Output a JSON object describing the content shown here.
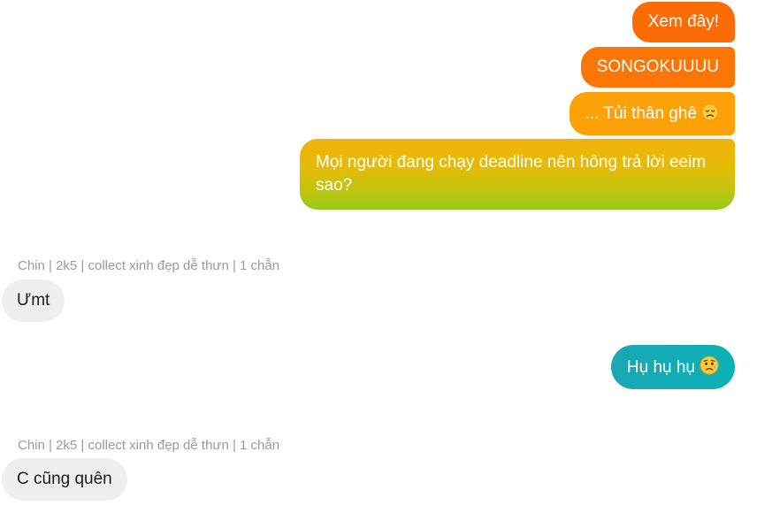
{
  "messages": [
    {
      "direction": "outgoing",
      "text": "Xem đây!"
    },
    {
      "direction": "outgoing",
      "text": "SONGOKUUUU"
    },
    {
      "direction": "outgoing",
      "text": "... Tủi thân ghê",
      "emoji": "disappointed-face"
    },
    {
      "direction": "outgoing",
      "text": "Mọi người đang chạy deadline nên hông trả lời eeim sao?"
    },
    {
      "direction": "incoming",
      "sender": "Chin | 2k5 | collect xinh đẹp dễ thưn | 1 chẫn",
      "text": "Ưmt"
    },
    {
      "direction": "outgoing",
      "text": "Hụ hụ hụ",
      "emoji": "sad-but-relieved-face"
    },
    {
      "direction": "incoming",
      "sender": "Chin | 2k5 | collect xinh đẹp dễ thưn | 1 chẫn",
      "text": "C cũng quên"
    }
  ],
  "colors": {
    "outgoing_orange": "#fb6b06",
    "outgoing_amber": "#fca107",
    "outgoing_gradient_top": "#f2b20a",
    "outgoing_gradient_bottom": "#97c81d",
    "outgoing_teal": "#0cb1b4",
    "incoming_bubble": "#efefef",
    "sender_text": "#9a9a9a"
  }
}
